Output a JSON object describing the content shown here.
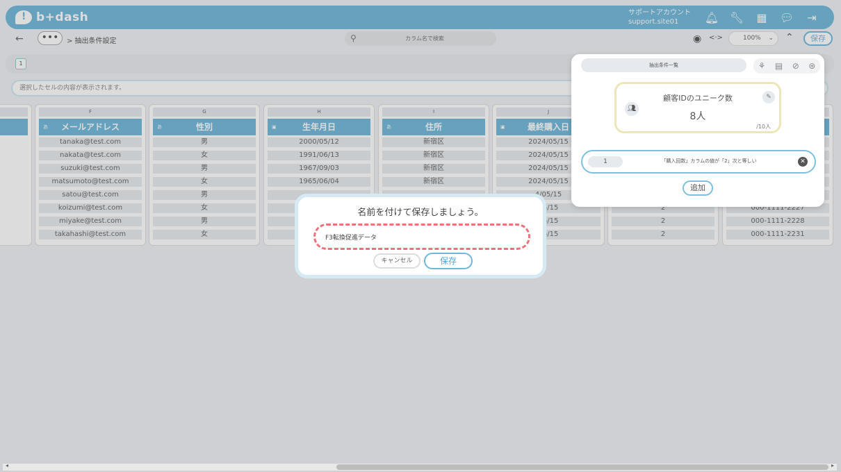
{
  "app": {
    "name": "b+dash"
  },
  "account": {
    "name": "サポートアカウント",
    "site": "support.site01"
  },
  "nav": {
    "breadcrumb": "> 抽出条件設定",
    "search_placeholder": "カラム名で検索",
    "zoom": "100%",
    "save_label": "保存"
  },
  "sheet": {
    "tab": "1"
  },
  "cellbar": {
    "text": "選択したセルの内容が表示されます。"
  },
  "grid": {
    "columns": [
      {
        "letter": "F",
        "header": "メールアドレス",
        "rows": [
          "tanaka@test.com",
          "nakata@test.com",
          "suzuki@test.com",
          "matsumoto@test.com",
          "satou@test.com",
          "koizumi@test.com",
          "miyake@test.com",
          "takahashi@test.com"
        ]
      },
      {
        "letter": "G",
        "header": "性別",
        "rows": [
          "男",
          "女",
          "男",
          "女",
          "男",
          "女",
          "男",
          "女"
        ]
      },
      {
        "letter": "H",
        "header": "生年月日",
        "rows": [
          "2000/05/12",
          "1991/06/13",
          "1967/09/03",
          "1965/06/04"
        ]
      },
      {
        "letter": "I",
        "header": "住所",
        "rows": [
          "新宿区",
          "新宿区",
          "新宿区",
          "新宿区"
        ]
      },
      {
        "letter": "J",
        "header": "最終購入日",
        "rows": [
          "2024/05/15",
          "2024/05/15",
          "2024/05/15",
          "2024/05/15",
          "4/05/15",
          "05/15",
          "05/15",
          "05/15"
        ]
      },
      {
        "letter": "",
        "header": "",
        "rows": [
          "",
          "",
          "",
          "",
          "",
          "2",
          "2",
          "2"
        ]
      },
      {
        "letter": "",
        "header": "",
        "rows": [
          "",
          "",
          "",
          "",
          "",
          "000-1111-2227",
          "000-1111-2228",
          "000-1111-2231"
        ]
      }
    ]
  },
  "panel": {
    "title": "抽出条件一覧",
    "card": {
      "title": "顧客IDのユニーク数",
      "value": "8人",
      "max": "/10人"
    },
    "condition": {
      "index": "1",
      "text": "「購入回数」カラムの値が「2」次と等しい"
    },
    "add_label": "追加"
  },
  "dialog": {
    "title": "名前を付けて保存しましょう。",
    "input_value": "F3転換促進データ",
    "cancel_label": "キャンセル",
    "save_label": "保存"
  },
  "colors": {
    "accent": "#6fb7db",
    "highlight": "#f0707a"
  }
}
